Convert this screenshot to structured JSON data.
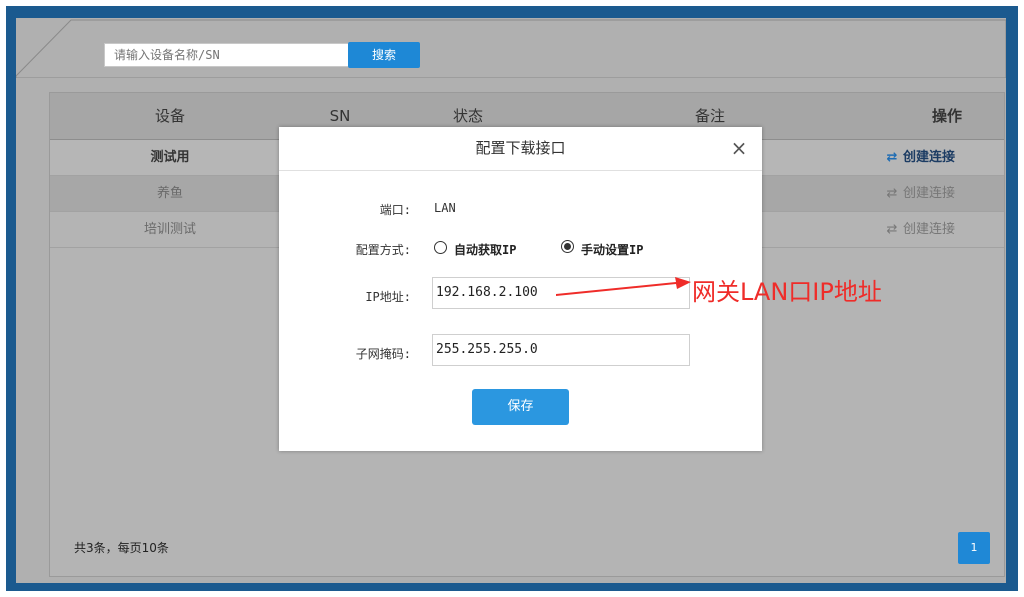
{
  "search": {
    "placeholder": "请输入设备名称/SN",
    "button_label": "搜索"
  },
  "table": {
    "headers": [
      "设备",
      "SN",
      "状态",
      "备注",
      "操作"
    ],
    "rows": [
      {
        "device": "测试用",
        "action": "创建连接"
      },
      {
        "device": "养鱼",
        "action": "创建连接"
      },
      {
        "device": "培训测试",
        "action": "创建连接"
      }
    ]
  },
  "footer": {
    "summary": "共3条，每页10条",
    "page": "1"
  },
  "modal": {
    "title": "配置下载接口",
    "close_glyph": "×",
    "port_label": "端口:",
    "port_value": "LAN",
    "mode_label": "配置方式:",
    "mode_options": [
      {
        "label": "自动获取IP",
        "selected": false
      },
      {
        "label": "手动设置IP",
        "selected": true
      }
    ],
    "ip_label": "IP地址:",
    "ip_value": "192.168.2.100",
    "mask_label": "子网掩码:",
    "mask_value": "255.255.255.0",
    "save_label": "保存"
  },
  "annotation": {
    "text": "网关LAN口IP地址",
    "color": "#ef2c29"
  },
  "colors": {
    "accent": "#1e88d6",
    "frame": "#1b5a8f",
    "overlay": "#b0b0b0"
  },
  "icons": {
    "link": "link-icon",
    "close": "close-icon"
  }
}
